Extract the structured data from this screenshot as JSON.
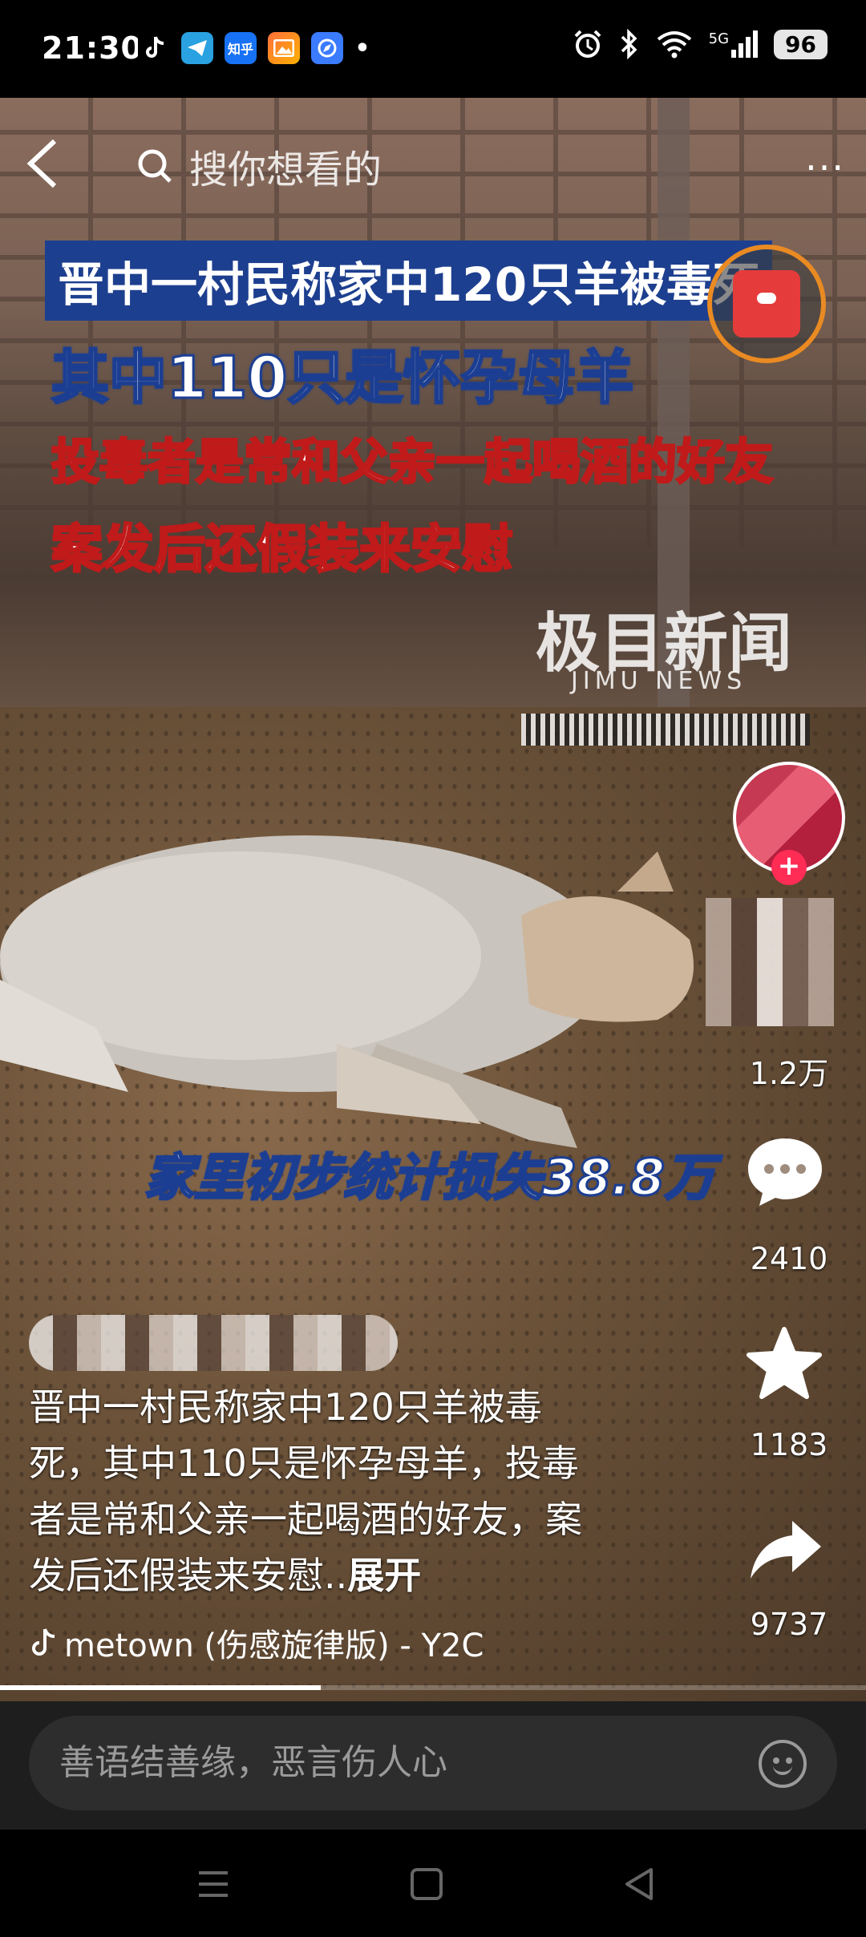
{
  "status_bar": {
    "time": "21:30",
    "network": "5G",
    "battery": "96",
    "notif_apps": [
      "tiktok-icon",
      "telegram-icon",
      "zhihu-icon",
      "gallery-icon",
      "browser-icon"
    ],
    "zhihu_label": "知乎",
    "dot": "•"
  },
  "top_nav": {
    "search_placeholder": "搜你想看的",
    "back": "‹",
    "more": "···"
  },
  "captions": {
    "line1": "晋中一村民称家中120只羊被毒死",
    "line2": "其中110只是怀孕母羊",
    "line3": "投毒者是常和父亲一起喝酒的好友",
    "line4": "案发后还假装来安慰",
    "loss": "家里初步统计损失38.8万"
  },
  "watermark": {
    "main": "极目新闻",
    "sub": "JIMU NEWS"
  },
  "side_actions": {
    "likes": "1.2万",
    "comments": "2410",
    "favorites": "1183",
    "shares": "9737",
    "follow": "+"
  },
  "description": {
    "text": "晋中一村民称家中120只羊被毒死，其中110只是怀孕母羊，投毒者是常和父亲一起喝酒的好友，案发后还假装来安慰..",
    "expand": "展开"
  },
  "music": {
    "title": "metown (伤感旋律版) - Y2C"
  },
  "playback": {
    "progress": 0.37
  },
  "comment_bar": {
    "placeholder": "善语结善缘，恶言伤人心"
  },
  "colors": {
    "caption_blue": "#1d3f8f",
    "caption_red": "#c01a1a",
    "red_packet_ring": "#e98a23",
    "follow_red": "#ff2c55"
  }
}
